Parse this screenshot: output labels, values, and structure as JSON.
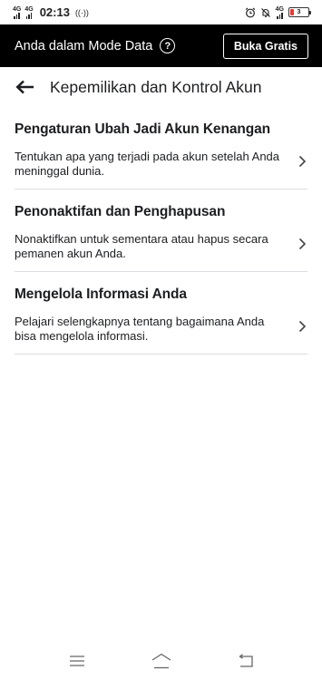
{
  "status_bar": {
    "network_1": "4G",
    "network_2": "4G",
    "time": "02:13",
    "vibrate_glyph": "((·))",
    "network_3": "4G",
    "battery_level": "3",
    "icons": [
      "alarm-icon",
      "mute-icon",
      "signal-icon",
      "battery-icon"
    ]
  },
  "banner": {
    "text": "Anda dalam Mode Data",
    "help_glyph": "?",
    "button_label": "Buka Gratis"
  },
  "header": {
    "title": "Kepemilikan dan Kontrol Akun",
    "back_icon": "arrow-left-icon"
  },
  "items": [
    {
      "title": "Pengaturan Ubah Jadi Akun Kenangan",
      "description": "Tentukan apa yang terjadi pada akun setelah Anda meninggal dunia."
    },
    {
      "title": "Penonaktifan dan Penghapusan",
      "description": "Nonaktifkan untuk sementara atau hapus secara pemanen akun Anda."
    },
    {
      "title": "Mengelola Informasi Anda",
      "description": "Pelajari selengkapnya tentang bagaimana Anda bisa mengelola informasi."
    }
  ],
  "colors": {
    "banner_bg": "#000000",
    "divider": "#dadde1",
    "text": "#1c1e21",
    "battery_low": "#e53935"
  },
  "nav_bar": {
    "icons": [
      "menu-icon",
      "home-icon",
      "back-icon"
    ]
  }
}
